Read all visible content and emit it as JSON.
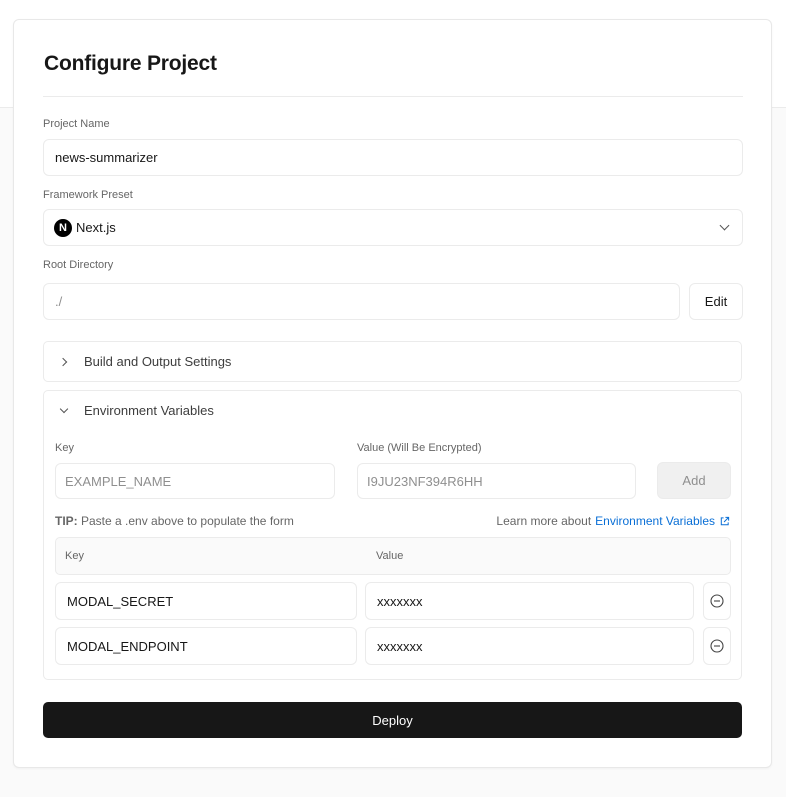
{
  "page": {
    "title": "Configure Project"
  },
  "project_name": {
    "label": "Project Name",
    "value": "news-summarizer"
  },
  "framework_preset": {
    "label": "Framework Preset",
    "selected": "Next.js",
    "logo_letter": "N"
  },
  "root_directory": {
    "label": "Root Directory",
    "value": "./",
    "edit_label": "Edit"
  },
  "build_settings": {
    "label": "Build and Output Settings",
    "expanded": false
  },
  "env_vars": {
    "label": "Environment Variables",
    "expanded": true,
    "key_label": "Key",
    "key_placeholder": "EXAMPLE_NAME",
    "value_label": "Value (Will Be Encrypted)",
    "value_placeholder": "I9JU23NF394R6HH",
    "add_label": "Add",
    "tip_prefix": "TIP:",
    "tip_text": " Paste a .env above to populate the form",
    "learn_more_text": "Learn more about",
    "learn_more_link": "Environment Variables",
    "link_color": "#0a6fd6",
    "table": {
      "columns": [
        "Key",
        "Value"
      ],
      "rows": [
        {
          "key": "MODAL_SECRET",
          "value": "xxxxxxx"
        },
        {
          "key": "MODAL_ENDPOINT",
          "value": "xxxxxxx"
        }
      ]
    }
  },
  "deploy": {
    "label": "Deploy",
    "color": "#171717"
  }
}
